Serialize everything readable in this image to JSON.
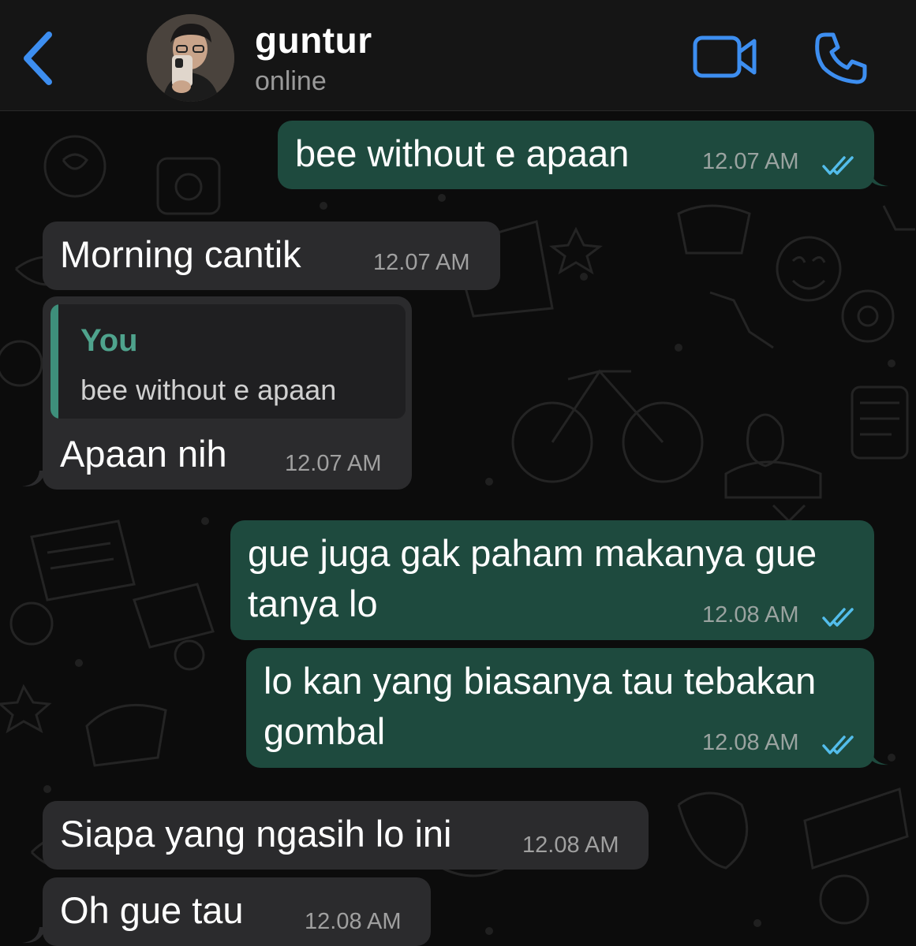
{
  "header": {
    "back_icon": "chevron-left-icon",
    "contact_name": "guntur",
    "status": "online",
    "video_icon": "video-camera-icon",
    "call_icon": "phone-icon",
    "accent_color": "#3d8ef0"
  },
  "messages": [
    {
      "direction": "outgoing",
      "text": "bee without e apaan",
      "time": "12.07 AM",
      "read": true
    },
    {
      "direction": "incoming",
      "text": "Morning cantik",
      "time": "12.07 AM"
    },
    {
      "direction": "incoming",
      "reply_to": {
        "author": "You",
        "text": "bee without e apaan"
      },
      "text": "Apaan nih",
      "time": "12.07 AM"
    },
    {
      "direction": "outgoing",
      "text_lines": [
        "gue juga gak paham makanya gue",
        "tanya lo"
      ],
      "time": "12.08 AM",
      "read": true
    },
    {
      "direction": "outgoing",
      "text_lines": [
        "lo kan yang biasanya tau tebakan",
        "gombal"
      ],
      "time": "12.08 AM",
      "read": true
    },
    {
      "direction": "incoming",
      "text": "Siapa yang ngasih lo ini",
      "time": "12.08 AM"
    },
    {
      "direction": "incoming",
      "text": "Oh gue tau",
      "time": "12.08 AM"
    }
  ],
  "colors": {
    "outgoing_bubble": "#1e4a3e",
    "incoming_bubble": "#2b2b2d",
    "read_ticks": "#53bdeb",
    "quote_accent": "#3e8f7b"
  }
}
